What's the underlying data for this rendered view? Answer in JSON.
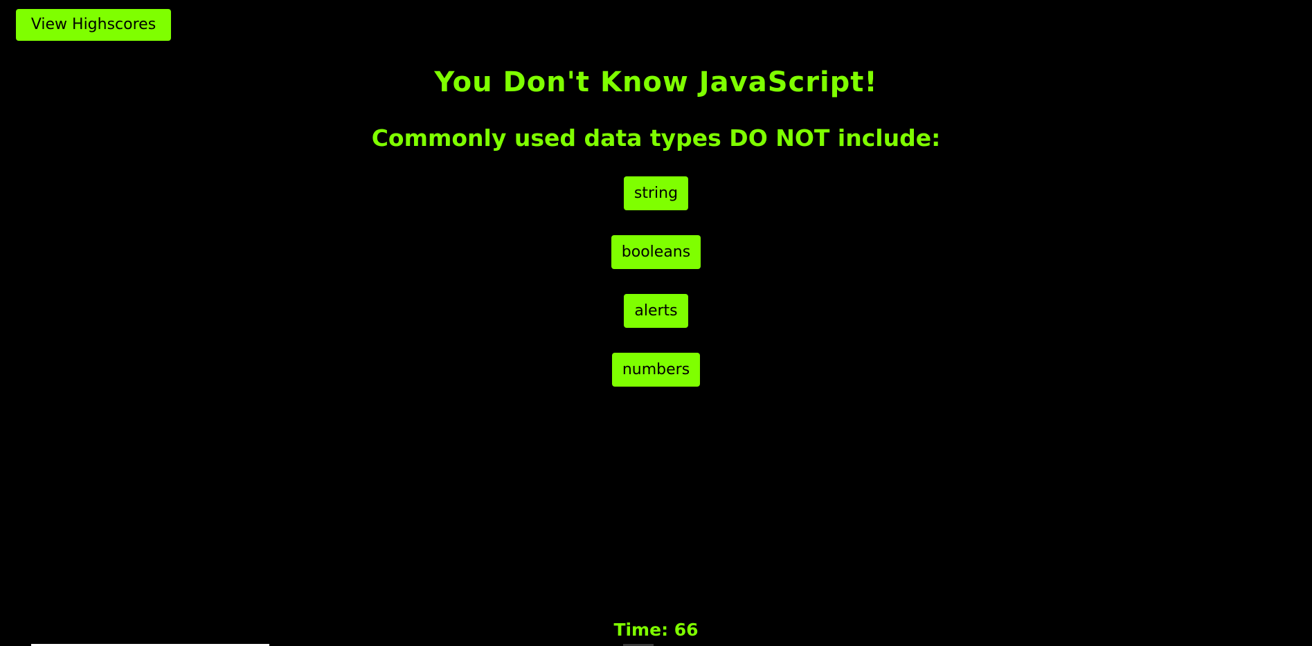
{
  "header": {
    "highscores_label": "View Highscores"
  },
  "quiz": {
    "title": "You Don't Know JavaScript!",
    "question": "Commonly used data types DO NOT include:",
    "choices": [
      {
        "label": "string"
      },
      {
        "label": "booleans"
      },
      {
        "label": "alerts"
      },
      {
        "label": "numbers"
      }
    ]
  },
  "timer": {
    "text": "Time: 66"
  },
  "colors": {
    "background": "#000000",
    "accent": "#7fff00",
    "button_text": "#000000"
  }
}
